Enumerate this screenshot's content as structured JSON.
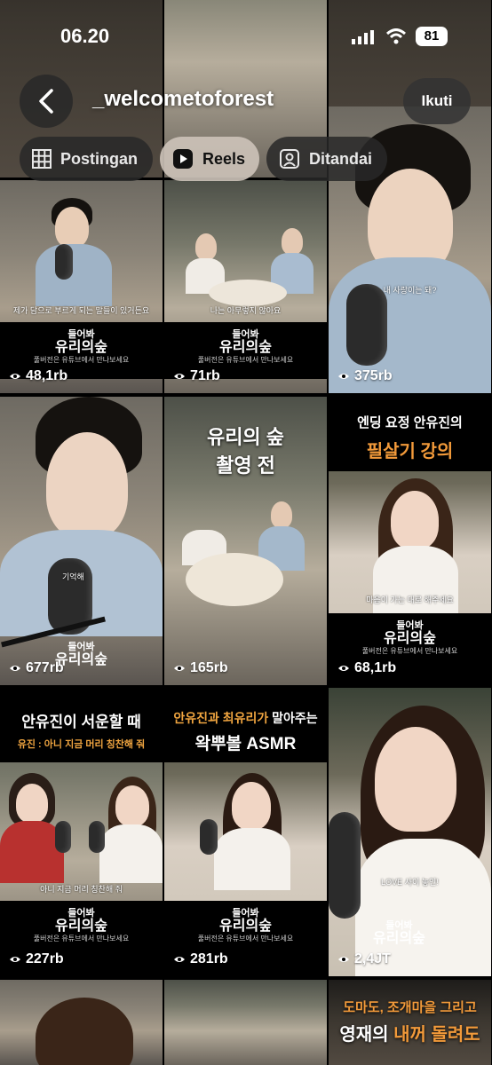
{
  "status_bar": {
    "time": "06.20",
    "battery": "81"
  },
  "header": {
    "username": "_welcometoforest",
    "follow_label": "Ikuti"
  },
  "tabs": [
    {
      "label": "Postingan",
      "icon": "grid-icon"
    },
    {
      "label": "Reels",
      "icon": "reels-icon",
      "active": true
    },
    {
      "label": "Ditandai",
      "icon": "tagged-icon"
    }
  ],
  "reels": [
    {
      "views": "48,1rb",
      "sub": "제가 담으로 부르게 되는 말들이 있거든요",
      "cap1": "들어봐",
      "cap2": "유리의숲",
      "cap3": "풀버전은 유튜브에서 만나보세요"
    },
    {
      "views": "71rb",
      "sub": "나는 아무렇지 않아요",
      "cap1": "들어봐",
      "cap2": "유리의숲",
      "cap3": "풀버전은 유튜브에서 만나보세요"
    },
    {
      "views": "375rb",
      "sub": "내 사랑이는 돼?"
    },
    {
      "views": "677rb",
      "sub": "기억해",
      "cap1": "들어봐",
      "cap2": "유리의숲",
      "cap3": "풀버전은 유튜브에서 만나보세요"
    },
    {
      "views": "165rb",
      "title1": "유리의 숲",
      "title2": "촬영 전"
    },
    {
      "views": "68,1rb",
      "top1": "엔딩 요정 안유진의",
      "top2": "필살기 강의",
      "sub": "마음이 가는 대로 해주세요",
      "cap1": "들어봐",
      "cap2": "유리의숲",
      "cap3": "풀버전은 유튜브에서 만나보세요"
    },
    {
      "views": "227rb",
      "top1": "안유진이 서운할 때",
      "top2": "유진 : 아니 지금 머리 칭찬해 줘",
      "sub": "아니 지금 머리 칭찬해 줘",
      "cap1": "들어봐",
      "cap2": "유리의숲",
      "cap3": "풀버전은 유튜브에서 만나보세요"
    },
    {
      "views": "281rb",
      "top1a": "안유진과",
      "top1b": "최유리가",
      "top1c": "말아주는",
      "top2": "왁뿌볼 ASMR",
      "cap1": "들어봐",
      "cap2": "유리의숲",
      "cap3": "풀버전은 유튜브에서 만나보세요"
    },
    {
      "views": "2,4JT",
      "sub": "LOVE 사이 놓인!",
      "cap1": "들어봐",
      "cap2": "유리의숲"
    },
    {
      "views": ""
    },
    {
      "views": ""
    },
    {
      "views": "",
      "top1": "도마도, 조개마을 그리고",
      "top2a": "영재의",
      "top2b": "내꺼 돌려도"
    }
  ]
}
